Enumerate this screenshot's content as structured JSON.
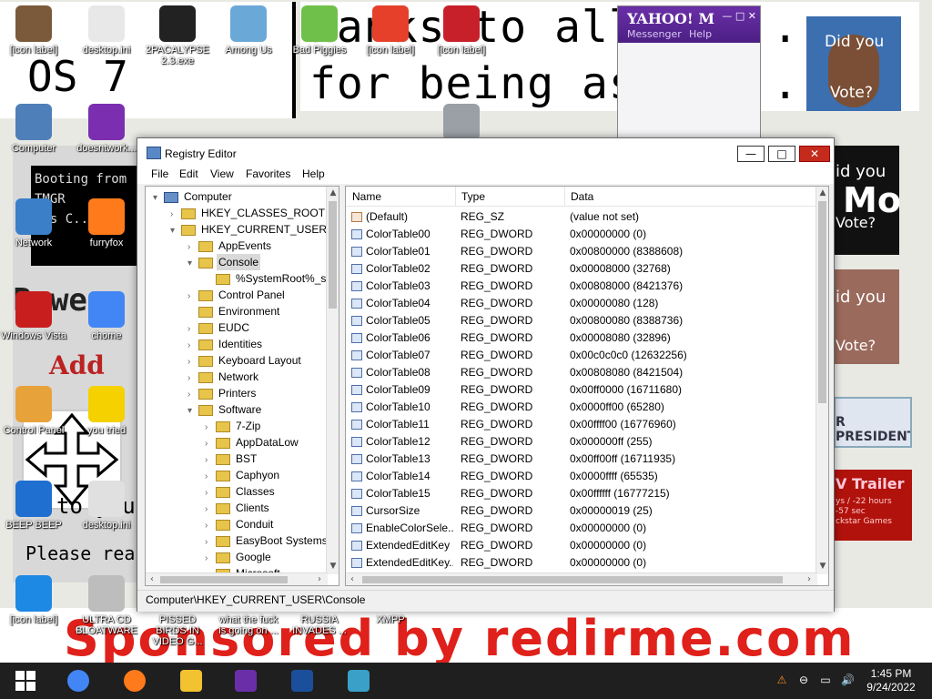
{
  "wallpaper": {
    "banner_top_line1": "hanks to all fa... ",
    "banner_top_line2": "for being assho...",
    "banner_left": "  OS 7",
    "left_strip_a": "Booting from\nTMGR\ness C...",
    "left_strip_b": "Powe",
    "left_strip_c": "Add",
    "left_strip_e": "to you",
    "left_strip_f": "Please rea",
    "bottom": "Sponsored by redirme.com",
    "right1_t1": "id you",
    "right1_t2": "Mo",
    "right1_t3": "Vote?",
    "right2_t1": "id you",
    "right2_t3": "Vote?",
    "right3": "R PRESIDENT",
    "right4_t": "V Trailer",
    "right4_s": "ys / -22 hours\n-57 sec\nckstar Games",
    "portrait_t1": "Did you",
    "portrait_t2": "Vote?"
  },
  "yahoo": {
    "logo": "YAHOO! M",
    "menu1": "Messenger",
    "menu2": "Help",
    "btns": "— □ ✕"
  },
  "desktop_icons": [
    {
      "label": "[icon label]",
      "color": "#7a5a3a"
    },
    {
      "label": "desktop.ini",
      "color": "#e8e8e8"
    },
    {
      "label": "2PACALYPSE 2.3.exe",
      "color": "#222222"
    },
    {
      "label": "Among Us",
      "color": "#6aa8d8"
    },
    {
      "label": "Bad Piggies",
      "color": "#6fc04a"
    },
    {
      "label": "[icon label]",
      "color": "#e6402a"
    },
    {
      "label": "[icon label]",
      "color": "#c8202a"
    },
    {
      "label": "Computer",
      "color": "#4f7fb8"
    },
    {
      "label": "doesntwork...",
      "color": "#7b2fb0"
    },
    {
      "label": "Network",
      "color": "#3b7fc8"
    },
    {
      "label": "furryfox",
      "color": "#ff7a1a"
    },
    {
      "label": "Windows Vista",
      "color": "#c81e1e"
    },
    {
      "label": "chome",
      "color": "#4285f4"
    },
    {
      "label": "Control Panel",
      "color": "#e8a23a"
    },
    {
      "label": "you tried",
      "color": "#f5d100"
    },
    {
      "label": "BEEP BEEP",
      "color": "#1e6fd0"
    },
    {
      "label": "desktop.ini",
      "color": "#e0e0e0"
    },
    {
      "label": "[icon label]",
      "color": "#1e88e5"
    },
    {
      "label": "ULTRA CD BLOATWARE",
      "color": "#bdbdbd"
    },
    {
      "label": "PISSED BIRDS IN VIDEO G...",
      "color": "#d32f2f"
    },
    {
      "label": "what the fuck is going on ...",
      "color": "#d32f2f"
    },
    {
      "label": "RUSSIA INVADES ...",
      "color": "#29b6f6"
    },
    {
      "label": "XMPP",
      "color": "#e6402a"
    },
    {
      "label": "",
      "color": "#9aa0a6"
    }
  ],
  "regedit": {
    "title": "Registry Editor",
    "buttons": {
      "min": "—",
      "max": "□",
      "close": "✕"
    },
    "menu": [
      "File",
      "Edit",
      "View",
      "Favorites",
      "Help"
    ],
    "tree": [
      {
        "label": "Computer",
        "level": 0,
        "arrow": "▾",
        "kind": "comp"
      },
      {
        "label": "HKEY_CLASSES_ROOT",
        "level": 1,
        "arrow": "›",
        "kind": "folder"
      },
      {
        "label": "HKEY_CURRENT_USER",
        "level": 1,
        "arrow": "▾",
        "kind": "folder"
      },
      {
        "label": "AppEvents",
        "level": 2,
        "arrow": "›",
        "kind": "folder"
      },
      {
        "label": "Console",
        "level": 2,
        "arrow": "▾",
        "kind": "folder",
        "selected": true
      },
      {
        "label": "%SystemRoot%_sy",
        "level": 3,
        "arrow": "",
        "kind": "folder"
      },
      {
        "label": "Control Panel",
        "level": 2,
        "arrow": "›",
        "kind": "folder"
      },
      {
        "label": "Environment",
        "level": 2,
        "arrow": "",
        "kind": "folder"
      },
      {
        "label": "EUDC",
        "level": 2,
        "arrow": "›",
        "kind": "folder"
      },
      {
        "label": "Identities",
        "level": 2,
        "arrow": "›",
        "kind": "folder"
      },
      {
        "label": "Keyboard Layout",
        "level": 2,
        "arrow": "›",
        "kind": "folder"
      },
      {
        "label": "Network",
        "level": 2,
        "arrow": "›",
        "kind": "folder"
      },
      {
        "label": "Printers",
        "level": 2,
        "arrow": "›",
        "kind": "folder"
      },
      {
        "label": "Software",
        "level": 2,
        "arrow": "▾",
        "kind": "folder"
      },
      {
        "label": "7-Zip",
        "level": 3,
        "arrow": "›",
        "kind": "folder"
      },
      {
        "label": "AppDataLow",
        "level": 3,
        "arrow": "›",
        "kind": "folder"
      },
      {
        "label": "BST",
        "level": 3,
        "arrow": "›",
        "kind": "folder"
      },
      {
        "label": "Caphyon",
        "level": 3,
        "arrow": "›",
        "kind": "folder"
      },
      {
        "label": "Classes",
        "level": 3,
        "arrow": "›",
        "kind": "folder"
      },
      {
        "label": "Clients",
        "level": 3,
        "arrow": "›",
        "kind": "folder"
      },
      {
        "label": "Conduit",
        "level": 3,
        "arrow": "›",
        "kind": "folder"
      },
      {
        "label": "EasyBoot Systems",
        "level": 3,
        "arrow": "›",
        "kind": "folder"
      },
      {
        "label": "Google",
        "level": 3,
        "arrow": "›",
        "kind": "folder"
      },
      {
        "label": "Microsoft",
        "level": 3,
        "arrow": "›",
        "kind": "folder"
      }
    ],
    "columns": {
      "name": "Name",
      "type": "Type",
      "data": "Data"
    },
    "values": [
      {
        "name": "(Default)",
        "type": "REG_SZ",
        "data": "(value not set)",
        "kind": "sz"
      },
      {
        "name": "ColorTable00",
        "type": "REG_DWORD",
        "data": "0x00000000 (0)",
        "kind": "dw"
      },
      {
        "name": "ColorTable01",
        "type": "REG_DWORD",
        "data": "0x00800000 (8388608)",
        "kind": "dw"
      },
      {
        "name": "ColorTable02",
        "type": "REG_DWORD",
        "data": "0x00008000 (32768)",
        "kind": "dw"
      },
      {
        "name": "ColorTable03",
        "type": "REG_DWORD",
        "data": "0x00808000 (8421376)",
        "kind": "dw"
      },
      {
        "name": "ColorTable04",
        "type": "REG_DWORD",
        "data": "0x00000080 (128)",
        "kind": "dw"
      },
      {
        "name": "ColorTable05",
        "type": "REG_DWORD",
        "data": "0x00800080 (8388736)",
        "kind": "dw"
      },
      {
        "name": "ColorTable06",
        "type": "REG_DWORD",
        "data": "0x00008080 (32896)",
        "kind": "dw"
      },
      {
        "name": "ColorTable07",
        "type": "REG_DWORD",
        "data": "0x00c0c0c0 (12632256)",
        "kind": "dw"
      },
      {
        "name": "ColorTable08",
        "type": "REG_DWORD",
        "data": "0x00808080 (8421504)",
        "kind": "dw"
      },
      {
        "name": "ColorTable09",
        "type": "REG_DWORD",
        "data": "0x00ff0000 (16711680)",
        "kind": "dw"
      },
      {
        "name": "ColorTable10",
        "type": "REG_DWORD",
        "data": "0x0000ff00 (65280)",
        "kind": "dw"
      },
      {
        "name": "ColorTable11",
        "type": "REG_DWORD",
        "data": "0x00ffff00 (16776960)",
        "kind": "dw"
      },
      {
        "name": "ColorTable12",
        "type": "REG_DWORD",
        "data": "0x000000ff (255)",
        "kind": "dw"
      },
      {
        "name": "ColorTable13",
        "type": "REG_DWORD",
        "data": "0x00ff00ff (16711935)",
        "kind": "dw"
      },
      {
        "name": "ColorTable14",
        "type": "REG_DWORD",
        "data": "0x0000ffff (65535)",
        "kind": "dw"
      },
      {
        "name": "ColorTable15",
        "type": "REG_DWORD",
        "data": "0x00ffffff (16777215)",
        "kind": "dw"
      },
      {
        "name": "CursorSize",
        "type": "REG_DWORD",
        "data": "0x00000019 (25)",
        "kind": "dw"
      },
      {
        "name": "EnableColorSele...",
        "type": "REG_DWORD",
        "data": "0x00000000 (0)",
        "kind": "dw"
      },
      {
        "name": "ExtendedEditKey",
        "type": "REG_DWORD",
        "data": "0x00000000 (0)",
        "kind": "dw"
      },
      {
        "name": "ExtendedEditKey...",
        "type": "REG_DWORD",
        "data": "0x00000000 (0)",
        "kind": "dw"
      }
    ],
    "status": "Computer\\HKEY_CURRENT_USER\\Console"
  },
  "taskbar": {
    "items": [
      {
        "name": "start",
        "color": "#ffffff"
      },
      {
        "name": "chrome",
        "color": "#4285f4"
      },
      {
        "name": "firefox",
        "color": "#ff7a1a"
      },
      {
        "name": "explorer",
        "color": "#f2c230"
      },
      {
        "name": "yahoo-messenger",
        "color": "#6a2fa8"
      },
      {
        "name": "powershell",
        "color": "#1b4f9c"
      },
      {
        "name": "registry-editor",
        "color": "#3aa0c8"
      }
    ],
    "tray": {
      "warn": "⚠",
      "circle": "⊖",
      "net": "▭",
      "vol": "🔊"
    },
    "time": "1:45 PM",
    "date": "9/24/2022"
  }
}
